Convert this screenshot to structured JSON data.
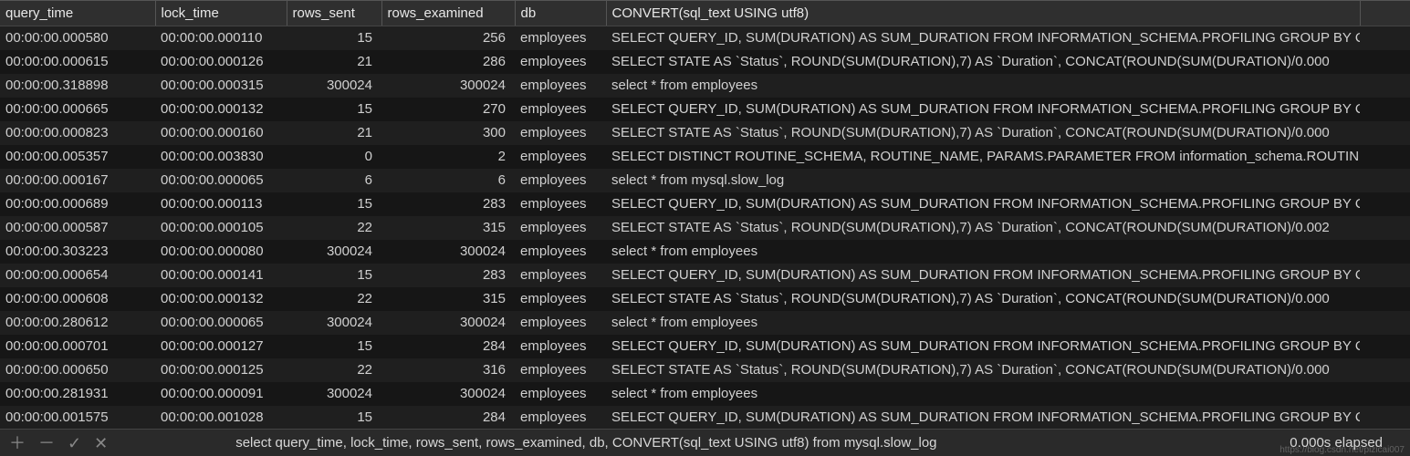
{
  "columns": {
    "query_time": "query_time",
    "lock_time": "lock_time",
    "rows_sent": "rows_sent",
    "rows_examined": "rows_examined",
    "db": "db",
    "sql_text": "CONVERT(sql_text USING utf8)"
  },
  "rows": [
    {
      "query_time": "00:00:00.000580",
      "lock_time": "00:00:00.000110",
      "rows_sent": "15",
      "rows_examined": "256",
      "db": "employees",
      "sql": "SELECT QUERY_ID, SUM(DURATION) AS SUM_DURATION FROM INFORMATION_SCHEMA.PROFILING GROUP BY Q"
    },
    {
      "query_time": "00:00:00.000615",
      "lock_time": "00:00:00.000126",
      "rows_sent": "21",
      "rows_examined": "286",
      "db": "employees",
      "sql": "SELECT STATE AS `Status`, ROUND(SUM(DURATION),7) AS `Duration`, CONCAT(ROUND(SUM(DURATION)/0.000"
    },
    {
      "query_time": "00:00:00.318898",
      "lock_time": "00:00:00.000315",
      "rows_sent": "300024",
      "rows_examined": "300024",
      "db": "employees",
      "sql": "select * from employees"
    },
    {
      "query_time": "00:00:00.000665",
      "lock_time": "00:00:00.000132",
      "rows_sent": "15",
      "rows_examined": "270",
      "db": "employees",
      "sql": "SELECT QUERY_ID, SUM(DURATION) AS SUM_DURATION FROM INFORMATION_SCHEMA.PROFILING GROUP BY Q"
    },
    {
      "query_time": "00:00:00.000823",
      "lock_time": "00:00:00.000160",
      "rows_sent": "21",
      "rows_examined": "300",
      "db": "employees",
      "sql": "SELECT STATE AS `Status`, ROUND(SUM(DURATION),7) AS `Duration`, CONCAT(ROUND(SUM(DURATION)/0.000"
    },
    {
      "query_time": "00:00:00.005357",
      "lock_time": "00:00:00.003830",
      "rows_sent": "0",
      "rows_examined": "2",
      "db": "employees",
      "sql": "SELECT DISTINCT ROUTINE_SCHEMA, ROUTINE_NAME, PARAMS.PARAMETER FROM information_schema.ROUTIN"
    },
    {
      "query_time": "00:00:00.000167",
      "lock_time": "00:00:00.000065",
      "rows_sent": "6",
      "rows_examined": "6",
      "db": "employees",
      "sql": "select * from mysql.slow_log"
    },
    {
      "query_time": "00:00:00.000689",
      "lock_time": "00:00:00.000113",
      "rows_sent": "15",
      "rows_examined": "283",
      "db": "employees",
      "sql": "SELECT QUERY_ID, SUM(DURATION) AS SUM_DURATION FROM INFORMATION_SCHEMA.PROFILING GROUP BY Q"
    },
    {
      "query_time": "00:00:00.000587",
      "lock_time": "00:00:00.000105",
      "rows_sent": "22",
      "rows_examined": "315",
      "db": "employees",
      "sql": "SELECT STATE AS `Status`, ROUND(SUM(DURATION),7) AS `Duration`, CONCAT(ROUND(SUM(DURATION)/0.002"
    },
    {
      "query_time": "00:00:00.303223",
      "lock_time": "00:00:00.000080",
      "rows_sent": "300024",
      "rows_examined": "300024",
      "db": "employees",
      "sql": "select * from employees"
    },
    {
      "query_time": "00:00:00.000654",
      "lock_time": "00:00:00.000141",
      "rows_sent": "15",
      "rows_examined": "283",
      "db": "employees",
      "sql": "SELECT QUERY_ID, SUM(DURATION) AS SUM_DURATION FROM INFORMATION_SCHEMA.PROFILING GROUP BY Q"
    },
    {
      "query_time": "00:00:00.000608",
      "lock_time": "00:00:00.000132",
      "rows_sent": "22",
      "rows_examined": "315",
      "db": "employees",
      "sql": "SELECT STATE AS `Status`, ROUND(SUM(DURATION),7) AS `Duration`, CONCAT(ROUND(SUM(DURATION)/0.000"
    },
    {
      "query_time": "00:00:00.280612",
      "lock_time": "00:00:00.000065",
      "rows_sent": "300024",
      "rows_examined": "300024",
      "db": "employees",
      "sql": "select * from employees"
    },
    {
      "query_time": "00:00:00.000701",
      "lock_time": "00:00:00.000127",
      "rows_sent": "15",
      "rows_examined": "284",
      "db": "employees",
      "sql": "SELECT QUERY_ID, SUM(DURATION) AS SUM_DURATION FROM INFORMATION_SCHEMA.PROFILING GROUP BY Q"
    },
    {
      "query_time": "00:00:00.000650",
      "lock_time": "00:00:00.000125",
      "rows_sent": "22",
      "rows_examined": "316",
      "db": "employees",
      "sql": "SELECT STATE AS `Status`, ROUND(SUM(DURATION),7) AS `Duration`, CONCAT(ROUND(SUM(DURATION)/0.000"
    },
    {
      "query_time": "00:00:00.281931",
      "lock_time": "00:00:00.000091",
      "rows_sent": "300024",
      "rows_examined": "300024",
      "db": "employees",
      "sql": "select * from employees"
    },
    {
      "query_time": "00:00:00.001575",
      "lock_time": "00:00:00.001028",
      "rows_sent": "15",
      "rows_examined": "284",
      "db": "employees",
      "sql": "SELECT QUERY_ID, SUM(DURATION) AS SUM_DURATION FROM INFORMATION_SCHEMA.PROFILING GROUP BY Q"
    }
  ],
  "statusbar": {
    "query": "select query_time, lock_time, rows_sent, rows_examined, db, CONVERT(sql_text USING utf8) from mysql.slow_log",
    "elapsed": "0.000s elapsed",
    "watermark": "https://blog.csdn.net/pizicai007",
    "icons": {
      "add": "＋",
      "remove": "－",
      "confirm": "✓",
      "cancel": "✕"
    }
  }
}
